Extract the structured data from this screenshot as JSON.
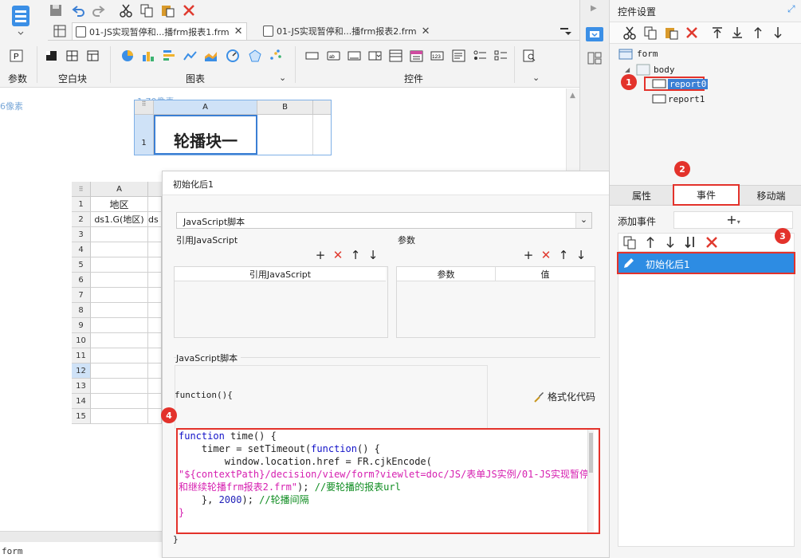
{
  "window": {
    "status": "form"
  },
  "tabs": [
    {
      "label": "01-JS实现暂停和...播frm报表1.frm",
      "active": true
    },
    {
      "label": "01-JS实现暂停和...播frm报表2.frm",
      "active": false
    }
  ],
  "ribbon": {
    "groups": [
      "参数",
      "空白块",
      "图表",
      "控件"
    ]
  },
  "canvas": {
    "width_label": "1 70像素",
    "left_label": "6像素",
    "carousel_cols": [
      "A",
      "B"
    ],
    "carousel_row": "1",
    "carousel_text": "轮播块一",
    "sheet_col": "A",
    "rows": [
      "1",
      "2",
      "3",
      "4",
      "5",
      "6",
      "7",
      "8",
      "9",
      "10",
      "11",
      "12",
      "13",
      "14",
      "15"
    ],
    "cell_a1": "地区",
    "cell_a2": "ds1.G(地区)",
    "cell_b2": "ds"
  },
  "dialog": {
    "title": "初始化后1",
    "type_value": "JavaScript脚本",
    "ref_js_label": "引用JavaScript",
    "params_label": "参数",
    "ref_js_col": "引用JavaScript",
    "param_col": "参数",
    "value_col": "值",
    "script_label": "JavaScript脚本",
    "fn_header": "function(){",
    "format_label": "格式化代码",
    "close_brace": "}",
    "code": {
      "l1_kw": "function",
      "l1_rest": " time() {",
      "l2_pre": "    timer = setTimeout(",
      "l2_kw": "function",
      "l2_rest": "() {",
      "l3": "        window.location.href = FR.cjkEncode(",
      "l4": "\"${contextPath}/decision/view/form?viewlet=doc/JS/表单JS实例/01-JS实现暂停",
      "l5_str": "和继续轮播frm报表2.frm\"",
      "l5_rest": "); ",
      "l5_cm": "//要轮播的报表url",
      "l6_pre": "    }, ",
      "l6_num": "2000",
      "l6_rest": "); ",
      "l6_cm": "//轮播间隔",
      "l7": "}"
    }
  },
  "right_panel": {
    "title": "控件设置",
    "tree": [
      "form",
      "body",
      "report0",
      "report1"
    ],
    "tabs": [
      "属性",
      "事件",
      "移动端"
    ],
    "add_event": "添加事件",
    "event_item": "初始化后1"
  },
  "badges": [
    "1",
    "2",
    "3",
    "4"
  ],
  "colors": {
    "accent": "#3b8fe6",
    "highlight": "#e3322b",
    "selected": "#2d8ce3"
  }
}
